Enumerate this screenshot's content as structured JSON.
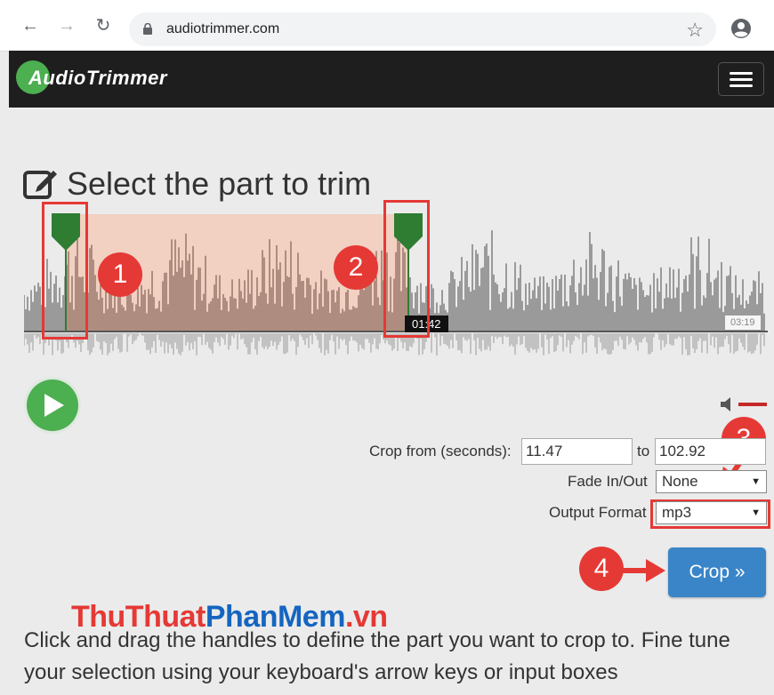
{
  "browser": {
    "url": "audiotrimmer.com",
    "back_icon": "arrow-left-icon",
    "forward_icon": "arrow-right-icon",
    "reload_icon": "reload-icon",
    "lock_icon": "lock-icon",
    "bookmark_icon": "star-icon",
    "profile_icon": "account-circle-icon"
  },
  "app": {
    "logo_text": "AudioTrimmer",
    "menu_icon": "hamburger-menu-icon"
  },
  "main": {
    "title": "Select the part to trim",
    "title_icon": "edit-icon",
    "waveform": {
      "selection_start_time": "01:42",
      "total_duration": "03:19"
    },
    "callouts": [
      "1",
      "2",
      "3",
      "4"
    ],
    "form": {
      "crop_from_label": "Crop from (seconds):",
      "crop_from_value": "11.47",
      "to_label": "to",
      "crop_to_value": "102.92",
      "fade_label": "Fade In/Out",
      "fade_value": "None",
      "format_label": "Output Format",
      "format_value": "mp3",
      "crop_button_label": "Crop »"
    },
    "watermark": {
      "part1": "ThuThuat",
      "part2": "PhanMem",
      "part3": ".vn"
    },
    "instructions": "Click and drag the handles to define the part you want to crop to. Fine tune your selection using your keyboard's arrow keys or input boxes"
  },
  "colors": {
    "accent_green": "#4caf50",
    "button_blue": "#3a85c8",
    "callout_red": "#e53935",
    "navbar": "#1e1e1e",
    "selection": "#f4c7b4"
  }
}
